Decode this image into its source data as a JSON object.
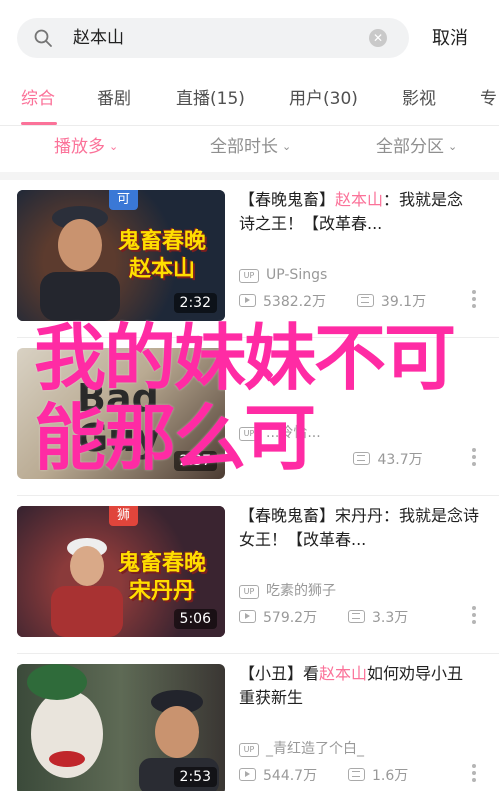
{
  "search": {
    "query": "赵本山",
    "cancel_label": "取消"
  },
  "tabs": [
    {
      "label": "综合",
      "active": true
    },
    {
      "label": "番剧",
      "active": false
    },
    {
      "label": "直播(15)",
      "active": false
    },
    {
      "label": "用户(30)",
      "active": false
    },
    {
      "label": "影视",
      "active": false
    },
    {
      "label": "专",
      "active": false
    }
  ],
  "filters": [
    {
      "label": "播放多",
      "active": true
    },
    {
      "label": "全部时长",
      "active": false
    },
    {
      "label": "全部分区",
      "active": false
    }
  ],
  "videos": [
    {
      "badge": "可",
      "badge_color": "#3a78d6",
      "thumb_caption": "鬼畜春晚\n赵本山",
      "duration": "2:32",
      "title_prefix": "【春晚鬼畜】",
      "title_highlight": "赵本山",
      "title_suffix": "：我就是念诗之王！【改革春...",
      "uploader": "UP-Sings",
      "plays": "5382.2万",
      "danmaku": "39.1万"
    },
    {
      "badge": "",
      "thumb_caption": "Bad Guy",
      "duration": "2:37",
      "title_prefix": "",
      "title_highlight": "",
      "title_suffix": "",
      "uploader": "...冷恰...",
      "plays": "",
      "danmaku": "43.7万"
    },
    {
      "badge": "狮",
      "badge_color": "#e0453b",
      "thumb_caption": "鬼畜春晚\n宋丹丹",
      "duration": "5:06",
      "title_prefix": "【春晚鬼畜】宋丹丹：我就是念诗女王！【改革春...",
      "title_highlight": "",
      "title_suffix": "",
      "uploader": "吃素的狮子",
      "plays": "579.2万",
      "danmaku": "3.3万"
    },
    {
      "badge": "",
      "thumb_caption": "",
      "duration": "2:53",
      "title_prefix": "【小丑】看",
      "title_highlight": "赵本山",
      "title_suffix": "如何劝导小丑重获新生",
      "uploader": "_青红造了个白_",
      "plays": "544.7万",
      "danmaku": "1.6万"
    }
  ],
  "overlay_text": "我的妹妹不可能那么可",
  "colors": {
    "accent": "#fb7299",
    "overlay": "#ff2ba4"
  }
}
